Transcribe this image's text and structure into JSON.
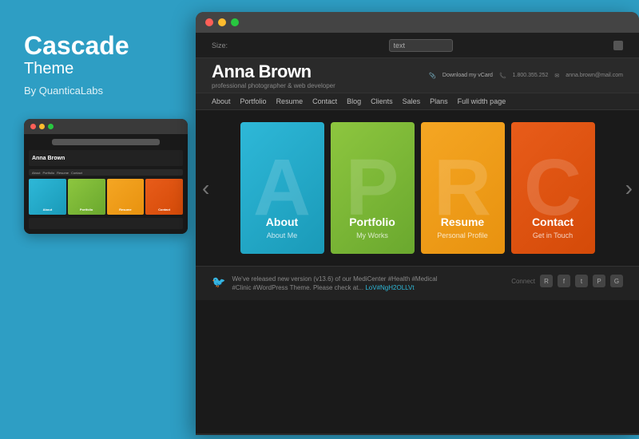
{
  "left": {
    "title": "Cascade",
    "subtitle": "Theme",
    "author": "By QuanticaLabs"
  },
  "small_browser": {
    "dots": [
      "red",
      "yellow",
      "green"
    ],
    "name": "Anna Brown",
    "nav_items": [
      "About",
      "Portfolio",
      "Resume",
      "Contact"
    ],
    "cards": [
      {
        "color": "#2eb8d8",
        "label": "About"
      },
      {
        "color": "#8dc63f",
        "label": "Portfolio"
      },
      {
        "color": "#f5a623",
        "label": "Resume"
      },
      {
        "color": "#e85c1a",
        "label": "Contact"
      }
    ]
  },
  "large_browser": {
    "dots": [
      "red",
      "yellow",
      "green"
    ],
    "site": {
      "name": "Anna Brown",
      "tagline": "professional photographer & web developer",
      "contact": {
        "vcard": "Download my vCard",
        "phone": "1.800.355.252",
        "email": "anna.brown@mail.com"
      },
      "nav_items": [
        "About",
        "Portfolio",
        "Resume",
        "Contact",
        "Blog",
        "Clients",
        "Sales",
        "Plans",
        "Full width page"
      ],
      "cards": [
        {
          "id": "about",
          "title": "About",
          "subtitle": "About Me",
          "letter": "A",
          "color_class": "card-blue"
        },
        {
          "id": "portfolio",
          "title": "Portfolio",
          "subtitle": "My Works",
          "letter": "P",
          "color_class": "card-green"
        },
        {
          "id": "resume",
          "title": "Resume",
          "subtitle": "Personal Profile",
          "letter": "R",
          "color_class": "card-yellow"
        },
        {
          "id": "contact",
          "title": "Contact",
          "subtitle": "Get in Touch",
          "letter": "C",
          "color_class": "card-orange"
        }
      ],
      "footer": {
        "tweet": "We've released new version (v13.6) of our MediCenter #Health #Medical #Clinic #WordPress Theme. Please check at... LoV#NgH2OLLVt",
        "connect_label": "Connect",
        "social_icons": [
          "rss",
          "facebook",
          "twitter",
          "pinterest",
          "google"
        ]
      }
    }
  }
}
